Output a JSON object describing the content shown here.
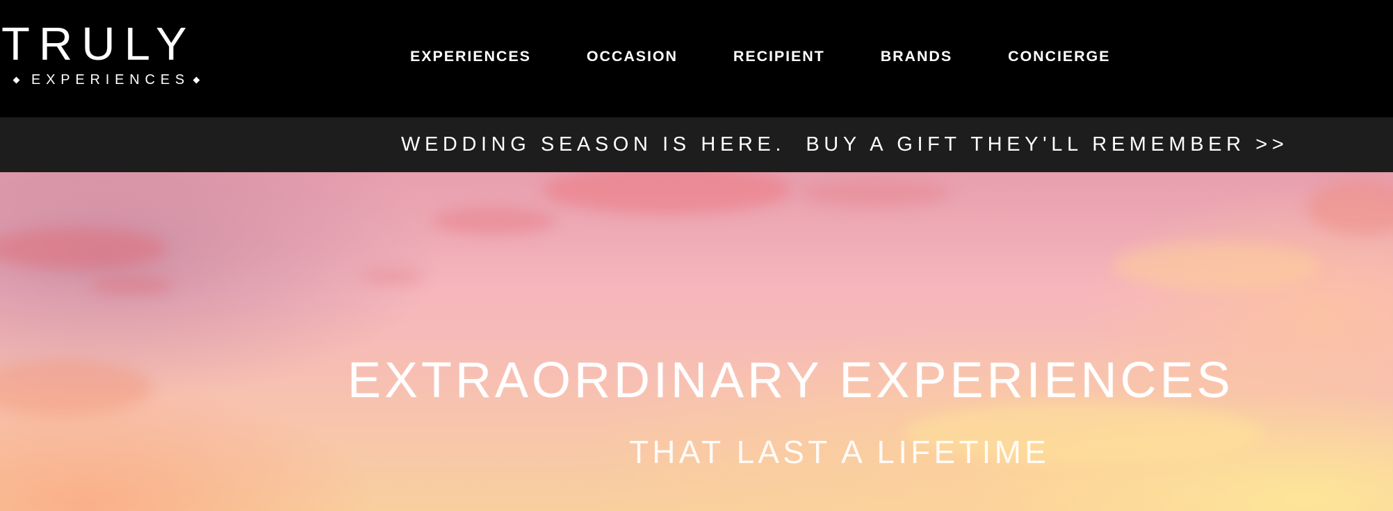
{
  "header": {
    "logo": {
      "main": "TRULY",
      "sub": "EXPERIENCES"
    },
    "nav": [
      {
        "label": "EXPERIENCES"
      },
      {
        "label": "OCCASION"
      },
      {
        "label": "RECIPIENT"
      },
      {
        "label": "BRANDS"
      },
      {
        "label": "CONCIERGE"
      }
    ]
  },
  "promo": {
    "text": "WEDDING SEASON IS HERE.  BUY A GIFT THEY'LL REMEMBER >>"
  },
  "hero": {
    "title": "EXTRAORDINARY EXPERIENCES",
    "subtitle": "THAT LAST A LIFETIME"
  },
  "colors": {
    "header_bg": "#000000",
    "promo_bg": "#1d1d1d",
    "text": "#ffffff",
    "sky_pink": "#f6b6bd",
    "sky_gold": "#f9cf9e"
  }
}
